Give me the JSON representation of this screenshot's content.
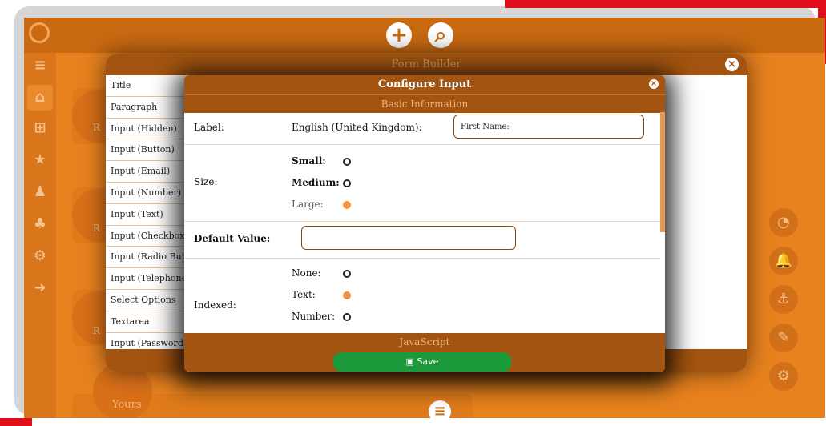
{
  "app": {
    "icons": {
      "logo": "user-outline-icon",
      "add": "plus-icon",
      "search": "search-icon"
    },
    "add_glyph": "+",
    "search_glyph": "⌕",
    "sidebar": [
      "≡",
      "⌂",
      "⊞",
      "★",
      "♟",
      "♣",
      "⚙",
      "➜"
    ],
    "cards_initial": [
      "R",
      "R",
      "R"
    ],
    "right_buttons": [
      "◔",
      "🔔",
      "⚓",
      "✎",
      "⚙"
    ],
    "bottom_label": "Yours",
    "menu_glyph": "≡"
  },
  "form_builder": {
    "title": "Form Builder",
    "close_glyph": "×",
    "items": [
      "Title",
      "Paragraph",
      "Input (Hidden)",
      "Input (Button)",
      "Input (Email)",
      "Input (Number)",
      "Input (Text)",
      "Input (Checkbox)",
      "Input (Radio Button)",
      "Input (Telephone)",
      "Select Options",
      "Textarea",
      "Input (Password)"
    ]
  },
  "configure_input": {
    "title": "Configure Input",
    "close_glyph": "×",
    "section": "Basic Information",
    "label_row": {
      "label": "Label:",
      "language": "English (United Kingdom):",
      "value": "First Name:"
    },
    "size_row": {
      "label": "Size:",
      "options": [
        {
          "name": "Small:",
          "selected": false
        },
        {
          "name": "Medium:",
          "selected": false
        },
        {
          "name": "Large:",
          "selected": true
        }
      ]
    },
    "default_row": {
      "label": "Default Value:",
      "value": ""
    },
    "index_row": {
      "label": "Indexed:",
      "options": [
        {
          "name": "None:",
          "selected": false
        },
        {
          "name": "Text:",
          "selected": true
        },
        {
          "name": "Number:",
          "selected": false
        }
      ]
    },
    "javascript_section": "JavaScript",
    "save_label": "Save",
    "save_glyph": "▣"
  },
  "colors": {
    "accent": "#e8821e",
    "dark_brown": "#a35410",
    "save_green": "#1a9a3a",
    "radio_on": "#f0923a"
  }
}
